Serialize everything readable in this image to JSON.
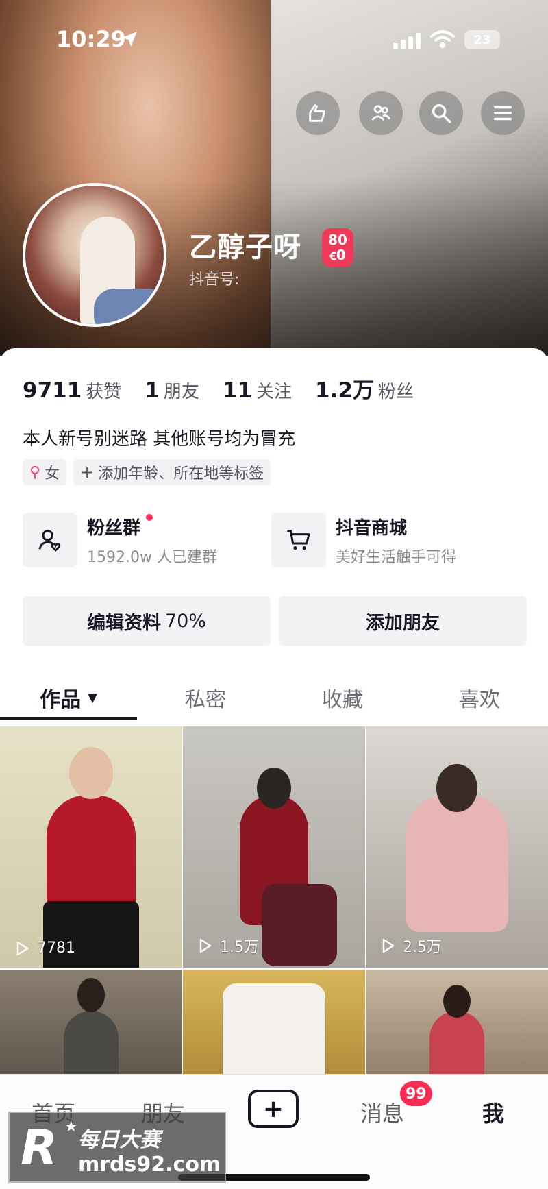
{
  "status_bar": {
    "time": "10:29",
    "battery": "23"
  },
  "profile": {
    "username": "乙醇子呀",
    "level_top": "80",
    "level_bottom": "ꞓ0",
    "douyin_id_label": "抖音号:"
  },
  "stats": [
    {
      "value": "9711",
      "label": "获赞"
    },
    {
      "value": "1",
      "label": "朋友"
    },
    {
      "value": "11",
      "label": "关注"
    },
    {
      "value": "1.2万",
      "label": "粉丝"
    }
  ],
  "bio": "本人新号别迷路 其他账号均为冒充",
  "tags": {
    "gender": "女",
    "add": "添加年龄、所在地等标签"
  },
  "services": {
    "fan_group": {
      "title": "粉丝群",
      "subtitle": "1592.0w 人已建群"
    },
    "mall": {
      "title": "抖音商城",
      "subtitle": "美好生活触手可得"
    }
  },
  "actions": {
    "edit_label": "编辑资料",
    "edit_percent": "70%",
    "add_friend": "添加朋友"
  },
  "tabs": [
    "作品",
    "私密",
    "收藏",
    "喜欢"
  ],
  "videos": [
    {
      "plays": "7781"
    },
    {
      "plays": "1.5万"
    },
    {
      "plays": "2.5万"
    },
    {
      "plays": ""
    },
    {
      "plays": ""
    },
    {
      "plays": ""
    }
  ],
  "nav": {
    "home": "首页",
    "friends": "朋友",
    "messages": "消息",
    "messages_badge": "99",
    "me": "我"
  },
  "watermark": {
    "logo": "R",
    "title": "每日大赛",
    "url": "mrds92.com"
  },
  "colors": {
    "accent": "#fe2c55",
    "text": "#161823",
    "chip_bg": "#f2f2f4"
  }
}
